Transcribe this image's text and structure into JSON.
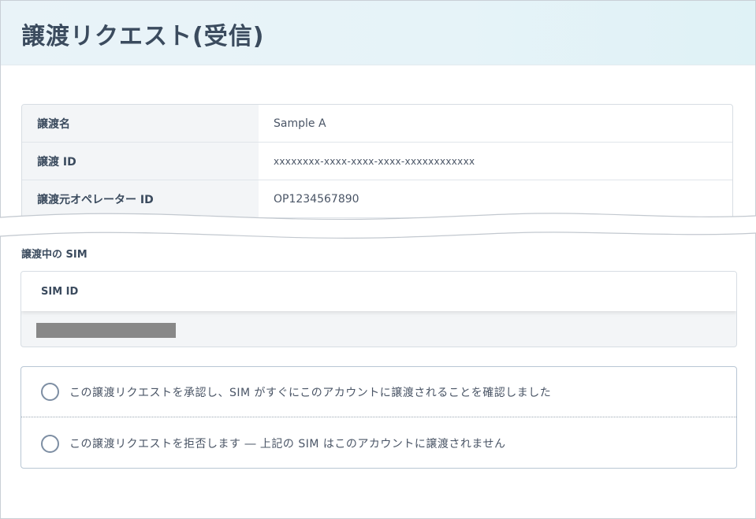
{
  "page": {
    "title": "譲渡リクエスト(受信)"
  },
  "info": {
    "rows": [
      {
        "label": "譲渡名",
        "value": "Sample A"
      },
      {
        "label": "譲渡 ID",
        "value": "xxxxxxxx-xxxx-xxxx-xxxx-xxxxxxxxxxxx"
      },
      {
        "label": "譲渡元オペレーター ID",
        "value": "OP1234567890"
      }
    ]
  },
  "sims": {
    "section_label": "譲渡中の SIM",
    "column_header": "SIM ID"
  },
  "options": {
    "accept_label": "この譲渡リクエストを承認し、SIM がすぐにこのアカウントに譲渡されることを確認しました",
    "reject_label": "この譲渡リクエストを拒否します ― 上記の SIM はこのアカウントに譲渡されません"
  }
}
